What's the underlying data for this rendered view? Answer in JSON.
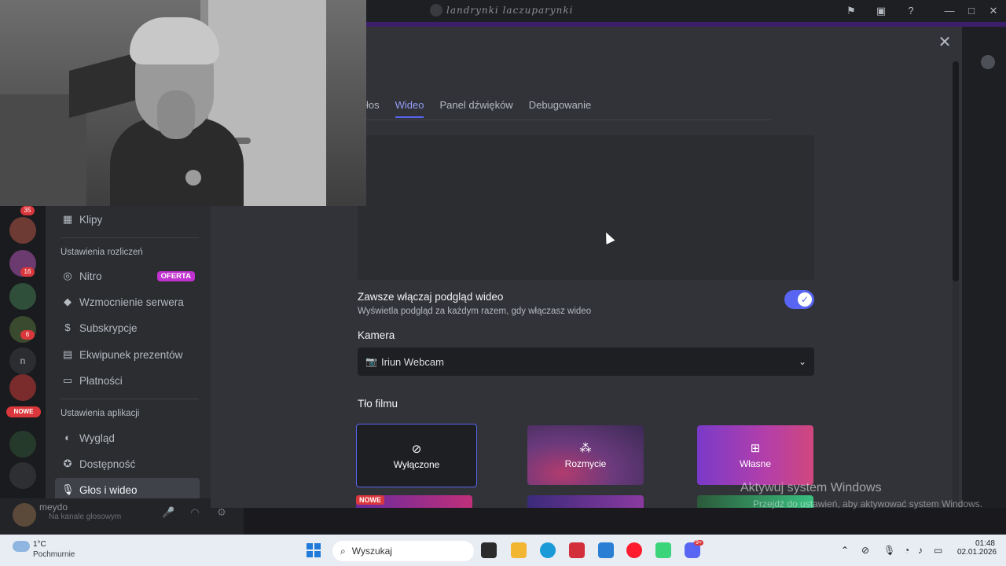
{
  "titlebar": {
    "title": "landrynki laczuparynki"
  },
  "sidebar": {
    "item_klipy": "Klipy",
    "section_billing": "Ustawienia rozliczeń",
    "item_nitro": "Nitro",
    "badge_oferta": "OFERTA",
    "item_boost": "Wzmocnienie serwera",
    "item_subs": "Subskrypcje",
    "item_gifts": "Ekwipunek prezentów",
    "item_payments": "Płatności",
    "section_app": "Ustawienia aplikacji",
    "item_appearance": "Wygląd",
    "item_accessibility": "Dostępność",
    "item_voice": "Głos i wideo"
  },
  "servers": {
    "badge1": "35",
    "badge2": "16",
    "badge3": "6",
    "nowe": "NOWE",
    "letter": "n"
  },
  "user": {
    "name": "meydo",
    "status": "Na kanale głosowym"
  },
  "tabs": {
    "t0": "łos",
    "t1": "Wideo",
    "t2": "Panel dźwięków",
    "t3": "Debugowanie"
  },
  "video": {
    "always_preview_label": "Zawsze włączaj podgląd wideo",
    "always_preview_desc": "Wyświetla podgląd za każdym razem, gdy włączasz wideo",
    "always_preview_on": true,
    "camera_label": "Kamera",
    "camera_value": "Iriun Webcam",
    "background_label": "Tło filmu",
    "bg_off": "Wyłączone",
    "bg_blur": "Rozmycie",
    "bg_custom": "Własne",
    "nowe_tag": "NOWE"
  },
  "watermark": {
    "line1": "Aktywuj system Windows",
    "line2": "Przejdź do ustawień, aby aktywować system Windows."
  },
  "taskbar": {
    "temp": "1°C",
    "weather": "Pochmurnie",
    "search_placeholder": "Wyszukaj",
    "discord_badge": "9+",
    "time": "01:48",
    "date": "02.01.2026"
  },
  "colors": {
    "accent": "#5865f2",
    "danger": "#da373c",
    "oferta": "#c031cf",
    "bg": "#313338",
    "sidebar": "#2b2d31"
  }
}
